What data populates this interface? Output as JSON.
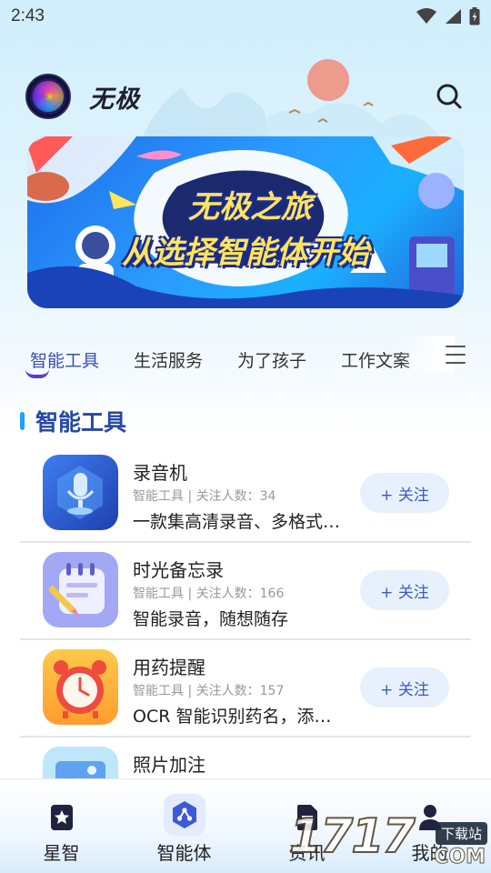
{
  "status_bar": {
    "time": "2:43"
  },
  "header": {
    "app_name": "无极"
  },
  "banner": {
    "line1": "无极之旅",
    "line2": "从选择智能体开始"
  },
  "tabs": [
    {
      "label": "智能工具",
      "active": true
    },
    {
      "label": "生活服务",
      "active": false
    },
    {
      "label": "为了孩子",
      "active": false
    },
    {
      "label": "工作文案",
      "active": false
    }
  ],
  "section": {
    "title": "智能工具"
  },
  "items": [
    {
      "title": "录音机",
      "category": "智能工具",
      "followers_label": "关注人数：",
      "followers": "34",
      "desc": "一款集高清录音、多格式…",
      "button": "+ 关注",
      "icon": "microphone-icon"
    },
    {
      "title": "时光备忘录",
      "category": "智能工具",
      "followers_label": "关注人数：",
      "followers": "166",
      "desc": "智能录音，随想随存",
      "button": "+ 关注",
      "icon": "memo-calendar-icon"
    },
    {
      "title": "用药提醒",
      "category": "智能工具",
      "followers_label": "关注人数：",
      "followers": "157",
      "desc": "OCR 智能识别药名，添…",
      "button": "+ 关注",
      "icon": "alarm-clock-icon"
    },
    {
      "title": "照片加注",
      "category": "",
      "followers_label": "",
      "followers": "",
      "desc": "",
      "button": "",
      "icon": "photo-icon"
    }
  ],
  "bottom_nav": [
    {
      "label": "星智",
      "icon": "star-bookmark-icon",
      "active": false
    },
    {
      "label": "智能体",
      "icon": "agent-hexagon-icon",
      "active": true
    },
    {
      "label": "资讯",
      "icon": "document-icon",
      "active": false
    },
    {
      "label": "我的",
      "icon": "person-icon",
      "active": false
    }
  ],
  "watermark": {
    "number": "1717",
    "tag": "下载站",
    "domain": "COM"
  },
  "colors": {
    "accent": "#3a4fb0",
    "section_bar": "#1da1ff",
    "follow_bg": "#e7f0fd"
  }
}
